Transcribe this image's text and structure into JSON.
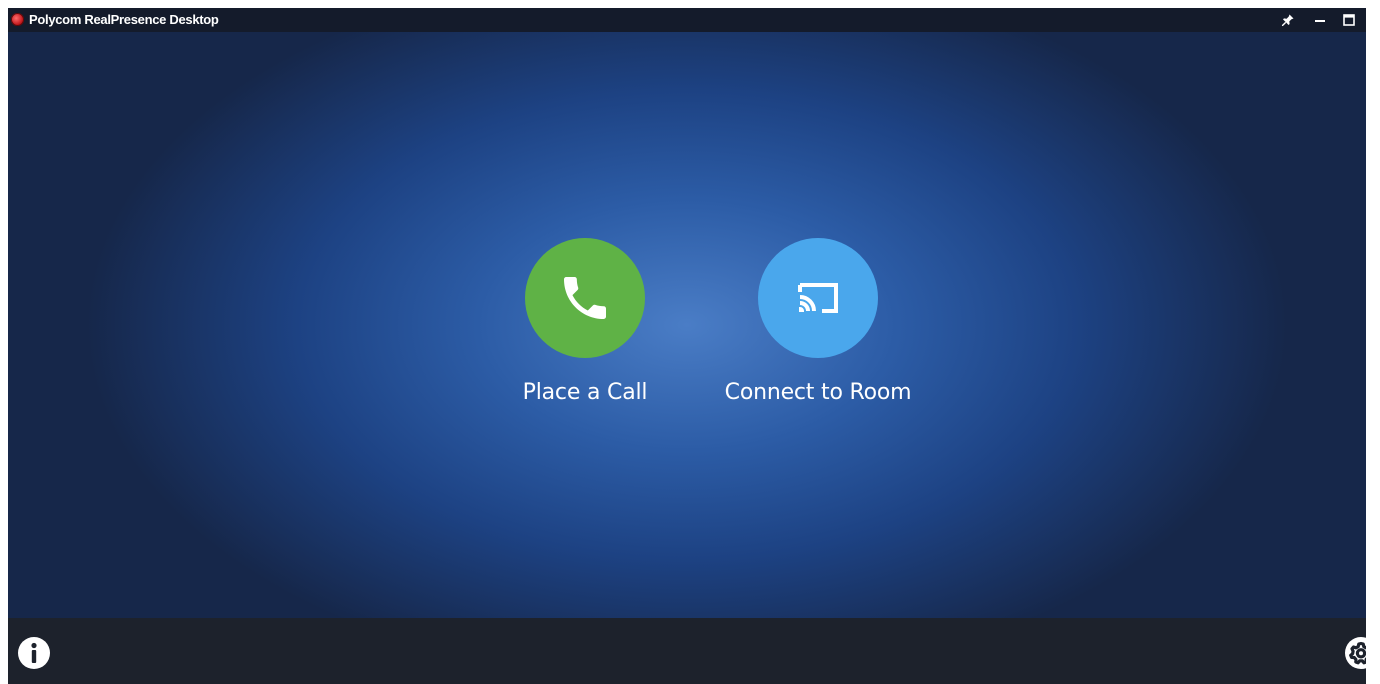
{
  "window": {
    "title": "Polycom RealPresence Desktop",
    "logo_icon": "polycom-logo-icon",
    "controls": {
      "pin_icon": "pin-icon",
      "minimize_icon": "minimize-icon",
      "maximize_icon": "maximize-icon"
    }
  },
  "main": {
    "actions": [
      {
        "label": "Place a Call",
        "icon": "phone-icon",
        "color": "#5fb246"
      },
      {
        "label": "Connect to Room",
        "icon": "cast-screen-icon",
        "color": "#4aa7ec"
      }
    ]
  },
  "footer": {
    "info_icon": "info-icon",
    "settings_icon": "gear-icon"
  },
  "colors": {
    "titlebar": "#141b2b",
    "background_center": "#4a7dc6",
    "background_edge": "#16274a",
    "bottombar": "#1d222c"
  }
}
